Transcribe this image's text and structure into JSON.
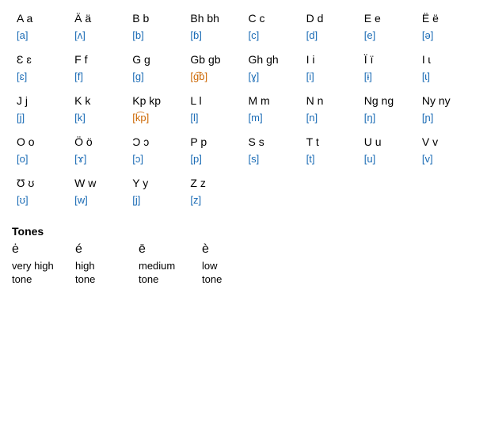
{
  "alphabet": [
    {
      "letter": "A a",
      "ipa": "[a]",
      "ipa_style": "blue"
    },
    {
      "letter": "Ä ä",
      "ipa": "[ʌ]",
      "ipa_style": "blue"
    },
    {
      "letter": "B b",
      "ipa": "[b]",
      "ipa_style": "blue"
    },
    {
      "letter": "Bh bh",
      "ipa": "[ɓ]",
      "ipa_style": "blue"
    },
    {
      "letter": "C c",
      "ipa": "[c]",
      "ipa_style": "blue"
    },
    {
      "letter": "D d",
      "ipa": "[d]",
      "ipa_style": "blue"
    },
    {
      "letter": "E e",
      "ipa": "[e]",
      "ipa_style": "blue"
    },
    {
      "letter": "Ë ë",
      "ipa": "[ə]",
      "ipa_style": "blue"
    },
    {
      "letter": "Ɛ ɛ",
      "ipa": "[ɛ]",
      "ipa_style": "blue"
    },
    {
      "letter": "F f",
      "ipa": "[f]",
      "ipa_style": "blue"
    },
    {
      "letter": "G g",
      "ipa": "[ɡ]",
      "ipa_style": "blue"
    },
    {
      "letter": "Gb gb",
      "ipa": "[g͡b]",
      "ipa_style": "orange"
    },
    {
      "letter": "Gh gh",
      "ipa": "[ɣ]",
      "ipa_style": "blue"
    },
    {
      "letter": "I i",
      "ipa": "[i]",
      "ipa_style": "blue"
    },
    {
      "letter": "Ï ï",
      "ipa": "[ɨ]",
      "ipa_style": "blue"
    },
    {
      "letter": "I ɩ",
      "ipa": "[ɩ]",
      "ipa_style": "blue"
    },
    {
      "letter": "J j",
      "ipa": "[j]",
      "ipa_style": "blue"
    },
    {
      "letter": "K k",
      "ipa": "[k]",
      "ipa_style": "blue"
    },
    {
      "letter": "Kp kp",
      "ipa": "[k͡p]",
      "ipa_style": "orange"
    },
    {
      "letter": "L l",
      "ipa": "[l]",
      "ipa_style": "blue"
    },
    {
      "letter": "M m",
      "ipa": "[m]",
      "ipa_style": "blue"
    },
    {
      "letter": "N n",
      "ipa": "[n]",
      "ipa_style": "blue"
    },
    {
      "letter": "Ng ng",
      "ipa": "[ŋ]",
      "ipa_style": "blue"
    },
    {
      "letter": "Ny ny",
      "ipa": "[ɲ]",
      "ipa_style": "blue"
    },
    {
      "letter": "O o",
      "ipa": "[o]",
      "ipa_style": "blue"
    },
    {
      "letter": "Ö ö",
      "ipa": "[ɤ]",
      "ipa_style": "blue"
    },
    {
      "letter": "Ɔ ɔ",
      "ipa": "[ɔ]",
      "ipa_style": "blue"
    },
    {
      "letter": "P p",
      "ipa": "[p]",
      "ipa_style": "blue"
    },
    {
      "letter": "S s",
      "ipa": "[s]",
      "ipa_style": "blue"
    },
    {
      "letter": "T t",
      "ipa": "[t]",
      "ipa_style": "blue"
    },
    {
      "letter": "U u",
      "ipa": "[u]",
      "ipa_style": "blue"
    },
    {
      "letter": "V v",
      "ipa": "[v]",
      "ipa_style": "blue"
    },
    {
      "letter": "Ʊ ʊ",
      "ipa": "[ʊ]",
      "ipa_style": "blue"
    },
    {
      "letter": "W w",
      "ipa": "[w]",
      "ipa_style": "blue"
    },
    {
      "letter": "Y y",
      "ipa": "[j]",
      "ipa_style": "blue"
    },
    {
      "letter": "Z z",
      "ipa": "[z]",
      "ipa_style": "blue"
    },
    {
      "letter": "",
      "ipa": ""
    },
    {
      "letter": "",
      "ipa": ""
    },
    {
      "letter": "",
      "ipa": ""
    },
    {
      "letter": "",
      "ipa": ""
    }
  ],
  "tones": {
    "title": "Tones",
    "items": [
      {
        "letter": "ė",
        "label": "very high\ntone"
      },
      {
        "letter": "é",
        "label": "high\ntone"
      },
      {
        "letter": "ē",
        "label": "medium\ntone"
      },
      {
        "letter": "è",
        "label": "low\ntone"
      }
    ]
  }
}
